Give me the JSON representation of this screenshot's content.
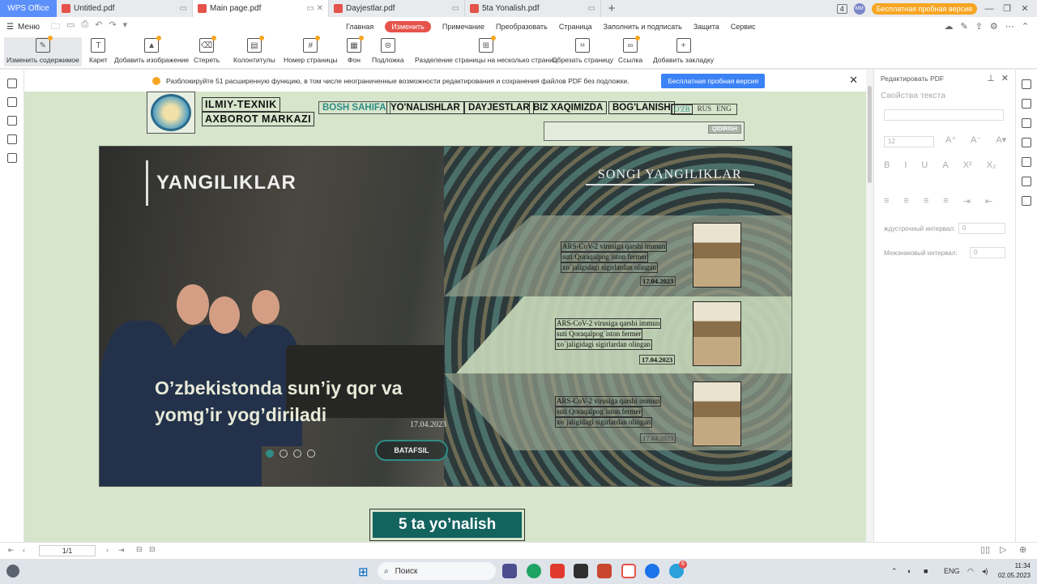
{
  "titlebar": {
    "app_tab": "WPS Office",
    "tabs": [
      {
        "label": "Untitled.pdf"
      },
      {
        "label": "Main page.pdf"
      },
      {
        "label": "Dayjestlar.pdf"
      },
      {
        "label": "5ta Yonalish.pdf"
      }
    ],
    "badge": "4",
    "avatar": "MM",
    "trial_label": "Бесплатная пробная версия"
  },
  "menubar": {
    "menu_label": "Меню",
    "tabs": [
      "Главная",
      "Изменить",
      "Примечание",
      "Преобразовать",
      "Страница",
      "Заполнить и подписать",
      "Защита",
      "Сервис"
    ]
  },
  "ribbon": {
    "items": [
      "Изменить содержимое",
      "Карет",
      "Добавить изображение",
      "Стереть",
      "Колонтитулы",
      "Номер страницы",
      "Фон",
      "Подложка",
      "Разделение страницы на несколько страниц",
      "Обрезать страницу",
      "Ссылка",
      "Добавить закладку"
    ]
  },
  "notice": {
    "text": "Разблокируйте 51 расширенную функцию, в том числе неограниченные возможности редактирования и сохранения файлов PDF без подложки.",
    "button": "Бесплатная пробная версия"
  },
  "right_panel": {
    "header": "Редактировать PDF",
    "title": "Свойства текста",
    "font_size": "12",
    "line_spacing_label": "ждустрочный интервал:",
    "line_spacing_value": "0",
    "char_spacing_label": "Межзнаковый интервал:",
    "char_spacing_value": "0"
  },
  "statusbar": {
    "page": "1/1"
  },
  "taskbar": {
    "search_label": "Поиск",
    "lang": "ENG",
    "time": "11:34",
    "date": "02.05.2023",
    "telegram_badge": "6"
  },
  "pdf": {
    "org_line1": "ILMIY-TEXNIK",
    "org_line2": "AXBOROT MARKAZI",
    "nav": [
      "BOSH SAHIFA",
      "YO'NALISHLAR",
      "DAYJESTLAR",
      "BIZ XAQIMIZDA",
      "BOG'LANISH"
    ],
    "langs": [
      "O'ZB",
      "RUS",
      "ENG"
    ],
    "search_btn": "QIDIRISH",
    "section_title": "YANGILIKLAR",
    "latest_title": "SONGI YANGILIKLAR",
    "headline": "O’zbekistonda sun’iy qor va yomg’ir yog’diriladi",
    "headline_date": "17.04.2023",
    "more_button": "BATAFSIL",
    "news": [
      {
        "l1": "ARS-CoV-2 virusiga qarshi immun",
        "l2": "suti Qoraqalpog`iston fermer",
        "l3": "xo`jaligidagi sigirlardan olingan",
        "date": "17.04.2023"
      },
      {
        "l1": "ARS-CoV-2 virusiga qarshi immun",
        "l2": "suti Qoraqalpog`iston fermer",
        "l3": "xo`jaligidagi sigirlardan olingan",
        "date": "17.04.2023"
      },
      {
        "l1": "ARS-CoV-2 virusiga qarshi immun",
        "l2": "suti Qoraqalpog`iston fermer",
        "l3": "xo`jaligidagi sigirlardan olingan",
        "date": "17.04.2023"
      }
    ],
    "directions_button": "5 ta yo’nalish"
  }
}
